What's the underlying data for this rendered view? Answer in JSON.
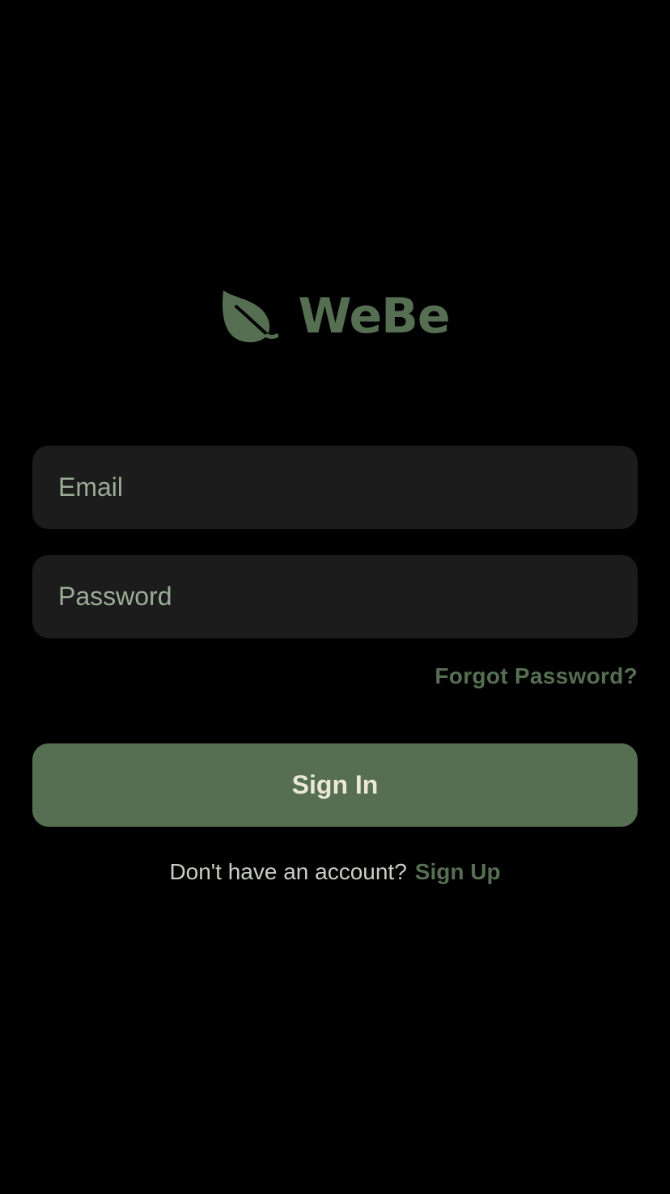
{
  "brand": {
    "name": "WeBe",
    "icon": "leaf-icon",
    "color": "#566f53"
  },
  "form": {
    "email": {
      "value": "",
      "placeholder": "Email"
    },
    "password": {
      "value": "",
      "placeholder": "Password"
    },
    "forgot_password_label": "Forgot Password?",
    "sign_in_label": "Sign In"
  },
  "footer": {
    "prompt": "Don't have an account?",
    "sign_up_label": "Sign Up"
  },
  "colors": {
    "background": "#000000",
    "field_background": "#1c1c1c",
    "accent": "#566f53",
    "button_text": "#ece8d8"
  }
}
